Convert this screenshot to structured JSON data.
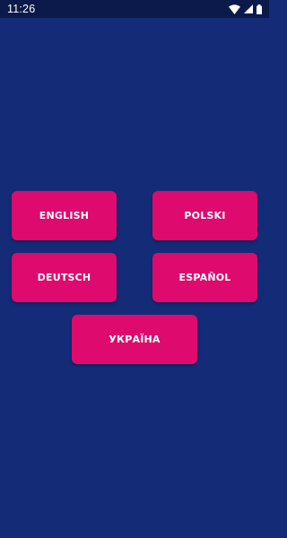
{
  "status_bar": {
    "time": "11:26",
    "icons": [
      "wifi-icon",
      "signal-icon",
      "battery-icon"
    ]
  },
  "colors": {
    "background": "#142b78",
    "status_bar": "#0b1a4a",
    "button": "#de0a6d",
    "button_text": "#ffffff"
  },
  "languages": {
    "english": "ENGLISH",
    "polski": "POLSKI",
    "deutsch": "DEUTSCH",
    "espanol": "ESPAÑOL",
    "ukraina": "УКРАЇНА"
  }
}
